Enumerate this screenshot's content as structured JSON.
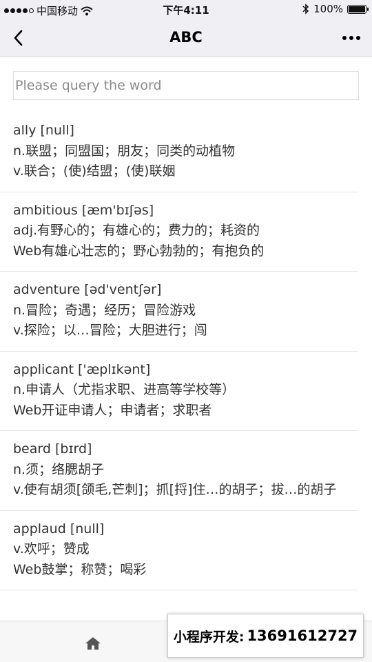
{
  "status_bar": {
    "carrier": "中国移动",
    "time": "下午4:11",
    "battery": "100%",
    "battery_level": 1.0
  },
  "nav": {
    "title": "ABC",
    "back_icon": "chevron-left-icon",
    "more_icon": "more-dots-icon"
  },
  "search": {
    "placeholder": "Please query the word",
    "value": ""
  },
  "words": [
    {
      "head": "ally [null]",
      "lines": [
        "n.联盟；同盟国；朋友；同类的动植物",
        "v.联合；(使)结盟；(使)联姻"
      ]
    },
    {
      "head": "ambitious [æm'bɪʃəs]",
      "lines": [
        "adj.有野心的；有雄心的；费力的；耗资的",
        "Web有雄心壮志的；野心勃勃的；有抱负的"
      ]
    },
    {
      "head": "adventure [əd'ventʃər]",
      "lines": [
        "n.冒险；奇遇；经历；冒险游戏",
        "v.探险；以…冒险；大胆进行；闯"
      ]
    },
    {
      "head": "applicant ['æplɪkənt]",
      "lines": [
        "n.申请人（尤指求职、进高等学校等）",
        "Web开证申请人；申请者；求职者"
      ]
    },
    {
      "head": "beard [bɪrd]",
      "lines": [
        "n.须；络腮胡子",
        "v.使有胡须[颌毛,芒刺]；抓[捋]住…的胡子；拔…的胡子"
      ]
    },
    {
      "head": "applaud [null]",
      "lines": [
        "v.欢呼；赞成",
        "Web鼓掌；称赞；喝彩"
      ]
    }
  ],
  "tab_bar": {
    "home_icon": "home-icon"
  },
  "promo": {
    "label": "小程序开发:",
    "number": "13691612727"
  }
}
